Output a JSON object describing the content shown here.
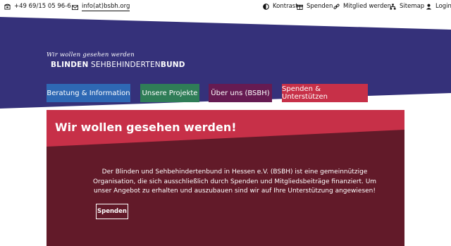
{
  "contact": {
    "phone": "+49 69/15 05 96-6",
    "email": "info(at)bsbh.org"
  },
  "utility_nav": [
    {
      "label": "Kontrast",
      "icon": "contrast-icon"
    },
    {
      "label": "Spenden",
      "icon": "gift-icon"
    },
    {
      "label": "Mitglied werden",
      "icon": "link-icon"
    },
    {
      "label": "Sitemap",
      "icon": "sitemap-icon"
    },
    {
      "label": "Login",
      "icon": "user-icon"
    }
  ],
  "logo": {
    "tagline": "Wir wollen gesehen werden",
    "part1": "BLINDEN",
    "part2": "SEHBEHINDERTEN",
    "part3": "BUND"
  },
  "main_nav": [
    {
      "label": "Beratung & Information",
      "color": "#2e68b4"
    },
    {
      "label": "Unsere Projekte",
      "color": "#2f7d57"
    },
    {
      "label": "Über uns (BSBH)",
      "color": "#661b52"
    },
    {
      "label": "Spenden & Unterstützen",
      "color": "#c73048"
    }
  ],
  "hero": {
    "title": "Wir wollen gesehen werden!",
    "text": "Der Blinden und Sehbehindertenbund in Hessen e.V. (BSBH) ist eine gemeinnützige Organisation, die sich ausschließlich durch Spenden und Mitgliedsbeiträge finanziert. Um unser Angebot zu erhalten und auszubauen sind wir auf Ihre Unterstützung angewiesen!",
    "button": "Spenden"
  },
  "colors": {
    "band": "#35317a",
    "hero_top": "#c73048",
    "hero_body": "#621a29"
  }
}
